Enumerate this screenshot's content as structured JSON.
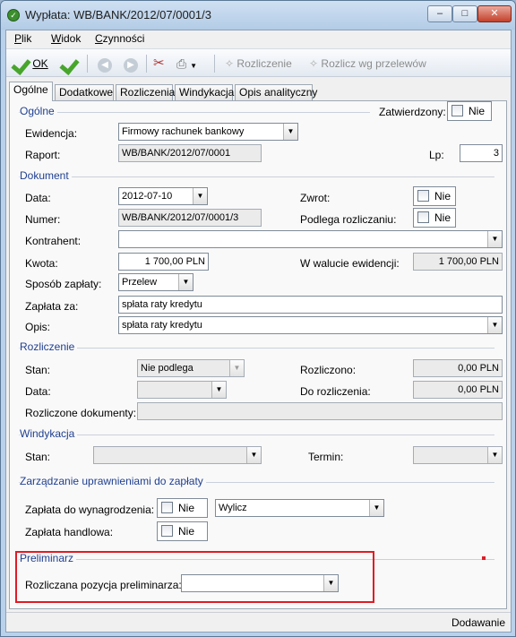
{
  "window": {
    "title": "Wypłata: WB/BANK/2012/07/0001/3",
    "minimize": "–",
    "maximize": "□",
    "close": "✕"
  },
  "menu": [
    "Plik",
    "Widok",
    "Czynności"
  ],
  "toolbar": {
    "ok": "OK",
    "rozliczenie": "Rozliczenie",
    "rozlicz_wg": "Rozlicz wg przelewów"
  },
  "tabs": [
    "Ogólne",
    "Dodatkowe",
    "Rozliczenia",
    "Windykacja",
    "Opis analityczny"
  ],
  "sections": {
    "ogolne": "Ogólne",
    "dokument": "Dokument",
    "rozliczenie": "Rozliczenie",
    "windykacja": "Windykacja",
    "zarzadzanie": "Zarządzanie uprawnieniami do zapłaty",
    "preliminarz": "Preliminarz"
  },
  "ogolne": {
    "zatwierdzony_label": "Zatwierdzony:",
    "zatwierdzony_value": "Nie",
    "ewidencja_label": "Ewidencja:",
    "ewidencja_value": "Firmowy rachunek bankowy",
    "raport_label": "Raport:",
    "raport_value": "WB/BANK/2012/07/0001",
    "lp_label": "Lp:",
    "lp_value": "3"
  },
  "dokument": {
    "data_label": "Data:",
    "data_value": "2012-07-10",
    "zwrot_label": "Zwrot:",
    "zwrot_value": "Nie",
    "numer_label": "Numer:",
    "numer_value": "WB/BANK/2012/07/0001/3",
    "podlega_label": "Podlega rozliczaniu:",
    "podlega_value": "Nie",
    "kontrahent_label": "Kontrahent:",
    "kontrahent_value": "",
    "kwota_label": "Kwota:",
    "kwota_value": "1 700,00 PLN",
    "walucie_label": "W walucie ewidencji:",
    "walucie_value": "1 700,00 PLN",
    "sposob_label": "Sposób zapłaty:",
    "sposob_value": "Przelew",
    "zaplata_za_label": "Zapłata za:",
    "zaplata_za_value": "spłata raty kredytu",
    "opis_label": "Opis:",
    "opis_value": "spłata raty kredytu"
  },
  "rozliczenie": {
    "stan_label": "Stan:",
    "stan_value": "Nie podlega",
    "rozliczono_label": "Rozliczono:",
    "rozliczono_value": "0,00 PLN",
    "data_label": "Data:",
    "data_value": "",
    "do_rozliczenia_label": "Do rozliczenia:",
    "do_rozliczenia_value": "0,00 PLN",
    "dokumenty_label": "Rozliczone dokumenty:",
    "dokumenty_value": ""
  },
  "windykacja": {
    "stan_label": "Stan:",
    "termin_label": "Termin:"
  },
  "zarzadzanie": {
    "wynagrodzenia_label": "Zapłata do wynagrodzenia:",
    "wynagrodzenia_value": "Nie",
    "wylicz_value": "Wylicz",
    "handlowa_label": "Zapłata handlowa:",
    "handlowa_value": "Nie"
  },
  "preliminarz": {
    "pozycja_label": "Rozliczana pozycja preliminarza:",
    "pozycja_value": ""
  },
  "status": "Dodawanie",
  "colors": {
    "section_text": "#1f3f8f",
    "highlight": "#e01b24"
  }
}
